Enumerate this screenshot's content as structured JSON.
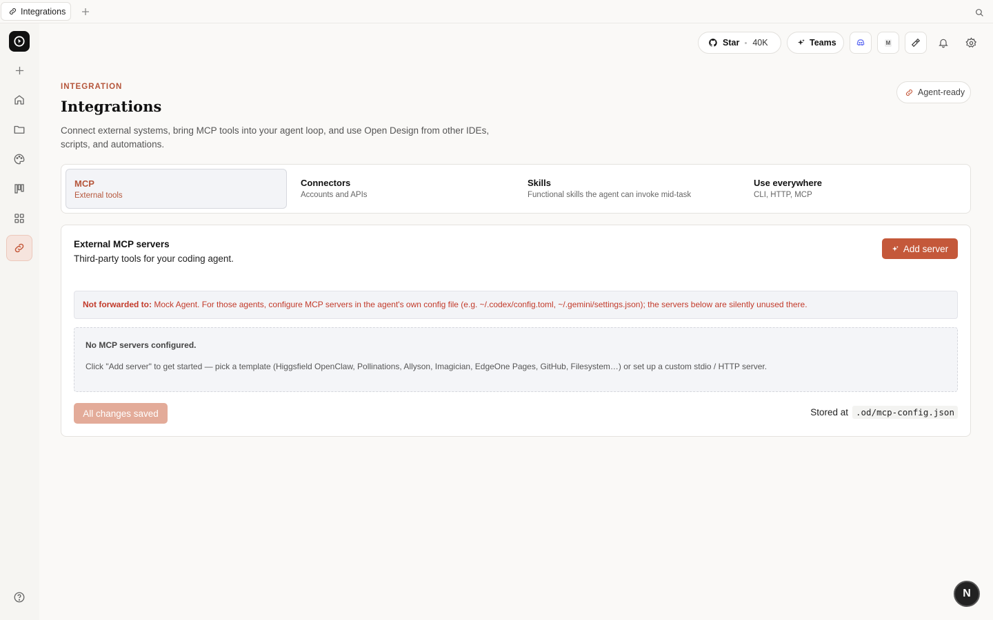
{
  "tabbar": {
    "tab_label": "Integrations"
  },
  "header": {
    "star_label": "Star",
    "star_count": "40K",
    "teams_label": "Teams",
    "status_icon_glyph": "M"
  },
  "page": {
    "eyebrow": "INTEGRATION",
    "title": "Integrations",
    "description": "Connect external systems, bring MCP tools into your agent loop, and use Open Design from other IDEs, scripts, and automations.",
    "badge": "Agent-ready"
  },
  "tabs": [
    {
      "title": "MCP",
      "subtitle": "External tools",
      "active": true
    },
    {
      "title": "Connectors",
      "subtitle": "Accounts and APIs",
      "active": false
    },
    {
      "title": "Skills",
      "subtitle": "Functional skills the agent can invoke mid-task",
      "active": false
    },
    {
      "title": "Use everywhere",
      "subtitle": "CLI, HTTP, MCP",
      "active": false
    }
  ],
  "mcp": {
    "title": "External MCP servers",
    "subtitle": "Third-party tools for your coding agent.",
    "add_button": "Add server",
    "warning_label": "Not forwarded to:",
    "warning_text": "Mock Agent. For those agents, configure MCP servers in the agent's own config file (e.g. ~/.codex/config.toml, ~/.gemini/settings.json); the servers below are silently unused there.",
    "empty_title": "No MCP servers configured.",
    "empty_desc": "Click \"Add server\" to get started — pick a template (Higgsfield OpenClaw, Pollinations, Allyson, Imagician, EdgeOne Pages, GitHub, Filesystem…) or set up a custom stdio / HTTP server.",
    "saved_button": "All changes saved",
    "stored_label": "Stored at",
    "stored_path": ".od/mcp-config.json"
  },
  "fab_label": "N",
  "colors": {
    "accent": "#c4583a",
    "accent_light": "#e3ab99",
    "warning": "#c23a2a"
  }
}
